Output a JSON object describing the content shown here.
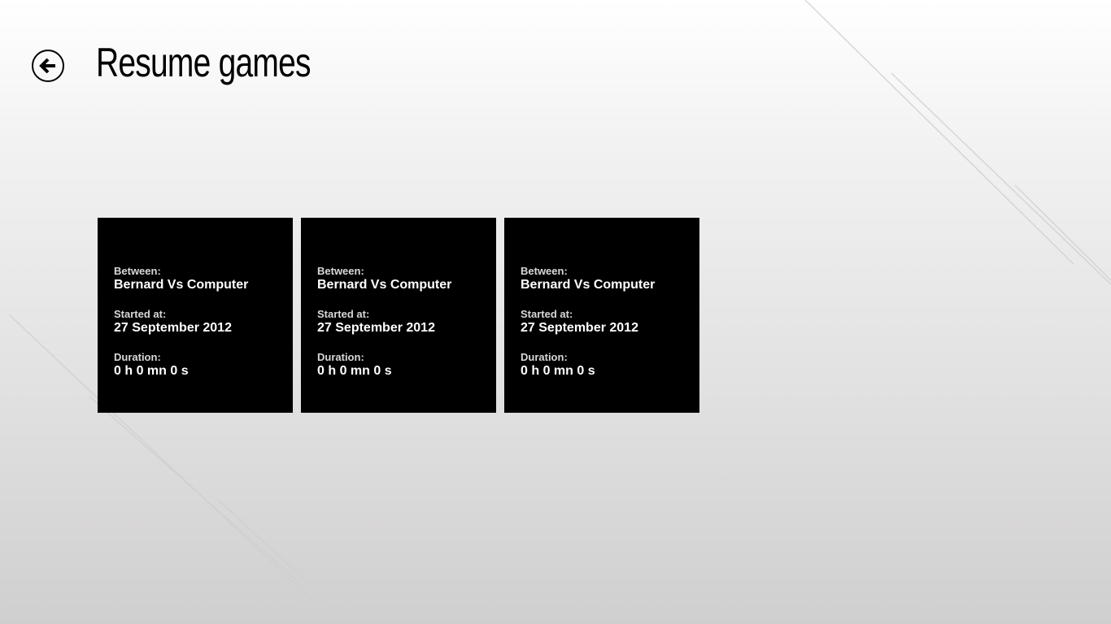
{
  "header": {
    "title": "Resume games",
    "back_icon": "arrow-left-circle-icon"
  },
  "games": [
    {
      "between_label": "Between:",
      "players": "Bernard Vs Computer",
      "started_label": "Started at:",
      "started": "27 September 2012",
      "duration_label": "Duration:",
      "duration": "0 h 0 mn 0 s"
    },
    {
      "between_label": "Between:",
      "players": "Bernard Vs Computer",
      "started_label": "Started at:",
      "started": "27 September 2012",
      "duration_label": "Duration:",
      "duration": "0 h 0 mn 0 s"
    },
    {
      "between_label": "Between:",
      "players": "Bernard Vs Computer",
      "started_label": "Started at:",
      "started": "27 September 2012",
      "duration_label": "Duration:",
      "duration": "0 h 0 mn 0 s"
    }
  ],
  "colors": {
    "tile_background": "#000000",
    "tile_text": "#ffffff",
    "page_background_top": "#ffffff",
    "page_background_bottom": "#d0cfd0"
  }
}
